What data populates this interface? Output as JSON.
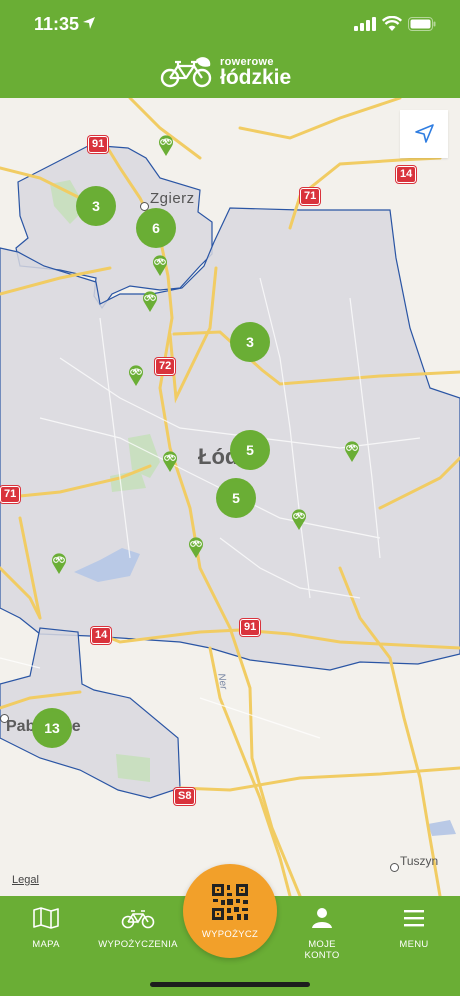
{
  "status": {
    "time": "11:35"
  },
  "brand": {
    "line1": "rowerowe",
    "line2": "łódzkie"
  },
  "map": {
    "places": {
      "zgierz": "Zgierz",
      "lodz": "Łódź",
      "pabianice": "Pabianice",
      "tuszyn": "Tuszyn",
      "ner": "Ner"
    },
    "roads": {
      "r91a": "91",
      "r71": "71",
      "r14a": "14",
      "r72": "72",
      "r71b": "71",
      "r14b": "14",
      "r91b": "91",
      "s8": "S8"
    },
    "clusters": [
      {
        "id": "c1",
        "count": "3"
      },
      {
        "id": "c2",
        "count": "6"
      },
      {
        "id": "c3",
        "count": "3"
      },
      {
        "id": "c4",
        "count": "5"
      },
      {
        "id": "c5",
        "count": "5"
      },
      {
        "id": "c6",
        "count": "13"
      }
    ],
    "legal": "Legal",
    "colors": {
      "brand_green": "#6aae35",
      "scan_orange": "#f2a02a",
      "road_shield": "#d9333c",
      "zone_fill": "#d8d8df",
      "zone_border": "#2a55a4"
    }
  },
  "tabs": {
    "map": "MAPA",
    "rentals": "WYPOŻYCZENIA",
    "rent": "WYPOŻYCZ",
    "account_l1": "MOJE",
    "account_l2": "KONTO",
    "menu": "MENU"
  }
}
